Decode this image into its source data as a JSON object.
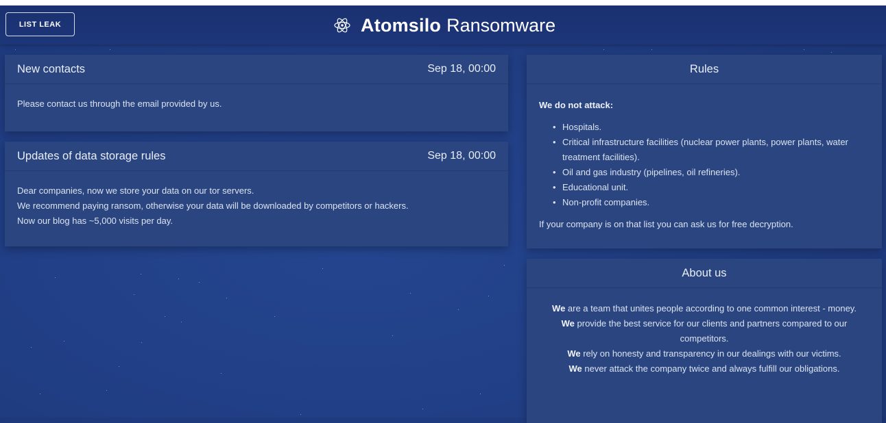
{
  "header": {
    "list_leak_label": "LIST LEAK",
    "brand_bold": "Atomsilo",
    "brand_rest": "Ransomware",
    "logo_icon": "atom-icon"
  },
  "posts": [
    {
      "title": "New contacts",
      "date": "Sep 18, 00:00",
      "lines": [
        "Please contact us through the email provided by us."
      ]
    },
    {
      "title": "Updates of data storage rules",
      "date": "Sep 18, 00:00",
      "lines": [
        "Dear companies, now we store your data on our tor servers.",
        "We recommend paying ransom, otherwise your data will be downloaded by competitors or hackers.",
        "Now our blog has ~5,000 visits per day."
      ]
    }
  ],
  "rules": {
    "title": "Rules",
    "lead": "We do not attack:",
    "items": [
      "Hospitals.",
      "Critical infrastructure facilities (nuclear power plants, power plants, water treatment facilities).",
      "Oil and gas industry (pipelines, oil refineries).",
      "Educational unit.",
      "Non-profit companies."
    ],
    "footer": "If your company is on that list you can ask us for free decryption."
  },
  "about": {
    "title": "About us",
    "lines": [
      {
        "bold": "We",
        "rest": " are a team that unites people according to one common interest - money."
      },
      {
        "bold": "We",
        "rest": " provide the best service for our clients and partners compared to our competitors."
      },
      {
        "bold": "We",
        "rest": " rely on honesty and transparency in our dealings with our victims."
      },
      {
        "bold": "We",
        "rest": " never attack the company twice and always fulfill our obligations."
      }
    ]
  },
  "colors": {
    "background": "#213f86",
    "topbar": "#1b3373",
    "card": "#2a457f",
    "text": "#e7ecf7"
  }
}
